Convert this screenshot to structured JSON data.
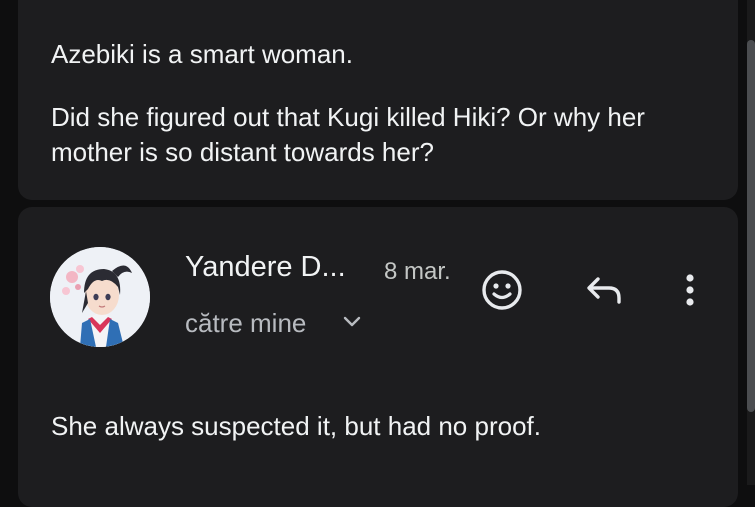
{
  "prev_message": {
    "paragraph1": "Azebiki is a smart woman.",
    "paragraph2": "Did she figured out that Kugi killed Hiki? Or why her mother is so distant towards her?"
  },
  "reply_message": {
    "sender": "Yandere D...",
    "date": "8 mar.",
    "recipient": "către mine",
    "body": "She always suspected it, but had no proof."
  },
  "icons": {
    "emoji": "smiley-face-icon",
    "reply": "reply-arrow-icon",
    "more": "more-vert-icon",
    "expand": "chevron-down-icon"
  }
}
